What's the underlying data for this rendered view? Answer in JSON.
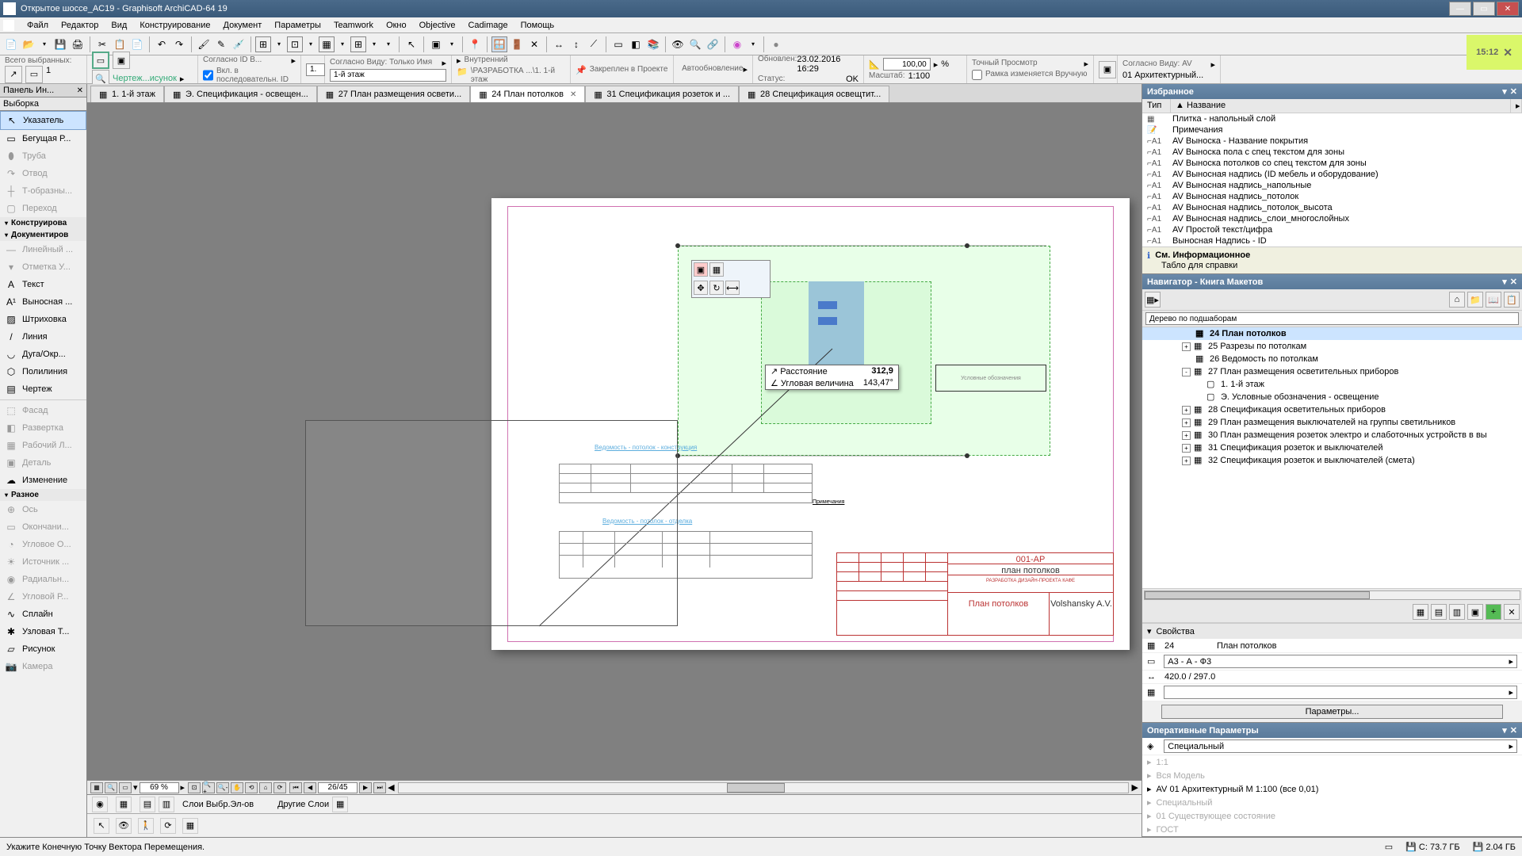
{
  "title": "Открытое шоссе_AC19 - Graphisoft ArchiCAD-64 19",
  "menu": [
    "Файл",
    "Редактор",
    "Вид",
    "Конструирование",
    "Документ",
    "Параметры",
    "Teamwork",
    "Окно",
    "Objective",
    "Cadimage",
    "Помощь"
  ],
  "inforow": {
    "selected_label": "Всего выбранных:",
    "selected_count": "1",
    "draw_label": "Чертеж...исунок",
    "accord_id": "Согласно ID В...",
    "accord_val": "1.",
    "seq_label": "Вкл. в последовательн. ID",
    "accord_view": "Согласно Виду: Только Имя",
    "floor": "1-й этаж",
    "internal": "Внутренний",
    "path": "\\РАЗРАБОТКА ...\\1. 1-й этаж",
    "anchor": "Закреплен в Проекте",
    "auto": "Автообновление",
    "updated_l": "Обновлен:",
    "updated_v": "23.02.2016 16:29",
    "status_l": "Статус:",
    "status_v": "OK",
    "scale_val": "100,00",
    "scale_pct": "%",
    "scale_l": "Масштаб:",
    "scale_r": "1:100",
    "preview": "Точный Просмотр",
    "frame": "Рамка изменяется Вручную",
    "view_l": "Согласно Виду: AV",
    "view_v": "01 Архитектурный..."
  },
  "clock": "15:12",
  "left_tools": {
    "header": "Панель  Ин...",
    "sub": "Выборка",
    "items": [
      {
        "icon": "↖",
        "label": "Указатель",
        "sel": true
      },
      {
        "icon": "▭",
        "label": "Бегущая Р..."
      },
      {
        "icon": "⬮",
        "label": "Труба",
        "dim": true
      },
      {
        "icon": "↷",
        "label": "Отвод",
        "dim": true
      },
      {
        "icon": "┼",
        "label": "Т-образны...",
        "dim": true
      },
      {
        "icon": "▢",
        "label": "Переход",
        "dim": true
      }
    ],
    "sections": [
      {
        "label": "Конструирова",
        "open": true
      },
      {
        "label": "Документиров",
        "open": true
      }
    ],
    "doc_items": [
      {
        "icon": "—",
        "label": "Линейный ...",
        "dim": true
      },
      {
        "icon": "▾",
        "label": "Отметка У...",
        "dim": true
      },
      {
        "icon": "A",
        "label": "Текст"
      },
      {
        "icon": "A¹",
        "label": "Выносная ..."
      },
      {
        "icon": "▨",
        "label": "Штриховка"
      },
      {
        "icon": "/",
        "label": "Линия"
      },
      {
        "icon": "◡",
        "label": "Дуга/Окр..."
      },
      {
        "icon": "⬡",
        "label": "Полилиния"
      },
      {
        "icon": "▤",
        "label": "Чертеж"
      },
      {
        "icon": "---",
        "label": "",
        "dim": true,
        "sep": true
      },
      {
        "icon": "⬚",
        "label": "Фасад",
        "dim": true
      },
      {
        "icon": "◧",
        "label": "Развертка",
        "dim": true
      },
      {
        "icon": "▦",
        "label": "Рабочий Л...",
        "dim": true
      },
      {
        "icon": "▣",
        "label": "Деталь",
        "dim": true
      },
      {
        "icon": "☁",
        "label": "Изменение"
      }
    ],
    "misc_label": "Разное",
    "misc_items": [
      {
        "icon": "⊕",
        "label": "Ось",
        "dim": true
      },
      {
        "icon": "▭",
        "label": "Окончани...",
        "dim": true
      },
      {
        "icon": "◔",
        "label": "Угловое О...",
        "dim": true
      },
      {
        "icon": "☀",
        "label": "Источник ...",
        "dim": true
      },
      {
        "icon": "◉",
        "label": "Радиальн...",
        "dim": true
      },
      {
        "icon": "∠",
        "label": "Угловой Р...",
        "dim": true
      },
      {
        "icon": "∿",
        "label": "Сплайн"
      },
      {
        "icon": "✱",
        "label": "Узловая Т..."
      },
      {
        "icon": "▱",
        "label": "Рисунок"
      },
      {
        "icon": "📷",
        "label": "Камера",
        "dim": true
      }
    ]
  },
  "tabs": [
    {
      "label": "1. 1-й этаж"
    },
    {
      "label": "Э. Спецификация - освещен..."
    },
    {
      "label": "27 План размещения освети..."
    },
    {
      "label": "24 План потолков",
      "active": true,
      "close": true
    },
    {
      "label": "31 Спецификация розеток и ..."
    },
    {
      "label": "28 Спецификация освещтит..."
    }
  ],
  "coord_tip": {
    "dist_l": "Расстояние",
    "dist_v": "312,9",
    "ang_l": "Угловая величина",
    "ang_v": "143,47°"
  },
  "zoom": {
    "pct": "69 %",
    "pages": "26/45"
  },
  "fav": {
    "title": "Избранное",
    "col1": "Тип",
    "col2": "▲ Название",
    "items": [
      {
        "t": "▦",
        "n": "Плитка - напольный слой"
      },
      {
        "t": "📝",
        "n": "Примечания"
      },
      {
        "t": "⌐A1",
        "n": "AV Выноска - Название покрытия"
      },
      {
        "t": "⌐A1",
        "n": "AV Выноска пола с спец текстом для зоны"
      },
      {
        "t": "⌐A1",
        "n": "AV Выноска потолков со спец текстом для зоны"
      },
      {
        "t": "⌐A1",
        "n": "AV Выносная надпись (ID мебель и оборудование)"
      },
      {
        "t": "⌐A1",
        "n": "AV Выносная надпись_напольные"
      },
      {
        "t": "⌐A1",
        "n": "AV Выносная надпись_потолок"
      },
      {
        "t": "⌐A1",
        "n": "AV Выносная надпись_потолок_высота"
      },
      {
        "t": "⌐A1",
        "n": "AV Выносная надпись_слои_многослойных"
      },
      {
        "t": "⌐A1",
        "n": "AV Простой текст/цифра"
      },
      {
        "t": "⌐A1",
        "n": "Выносная Надпись - ID"
      }
    ],
    "msg_title": "См. Информационное",
    "msg_body": "Табло для справки"
  },
  "nav": {
    "title": "Навигатор - Книга Макетов",
    "search_ph": "Дерево по подшаборам",
    "tree": [
      {
        "ind": 3,
        "exp": "",
        "icon": "▦",
        "label": "24 План потолков",
        "sel": true
      },
      {
        "ind": 3,
        "exp": "+",
        "icon": "▦",
        "label": "25 Разрезы по потолкам"
      },
      {
        "ind": 3,
        "exp": "",
        "icon": "▦",
        "label": "26 Ведомость по потолкам"
      },
      {
        "ind": 3,
        "exp": "-",
        "icon": "▦",
        "label": "27 План размещения осветительных приборов"
      },
      {
        "ind": 4,
        "exp": "",
        "icon": "▢",
        "label": "1. 1-й этаж"
      },
      {
        "ind": 4,
        "exp": "",
        "icon": "▢",
        "label": "Э. Условные обозначения - освещение"
      },
      {
        "ind": 3,
        "exp": "+",
        "icon": "▦",
        "label": "28 Спецификация осветительных приборов"
      },
      {
        "ind": 3,
        "exp": "+",
        "icon": "▦",
        "label": "29 План размещения выключателей на группы светильников"
      },
      {
        "ind": 3,
        "exp": "+",
        "icon": "▦",
        "label": "30 План размещения розеток электро и слаботочных устройств в вы"
      },
      {
        "ind": 3,
        "exp": "+",
        "icon": "▦",
        "label": "31 Спецификация розеток и выключателей"
      },
      {
        "ind": 3,
        "exp": "+",
        "icon": "▦",
        "label": "32 Спецификация розеток и выключателей (смета)"
      }
    ]
  },
  "props": {
    "title": "Свойства",
    "id": "24",
    "name": "План потолков",
    "format": "А3 - А - Ф3",
    "size": "420.0 / 297.0",
    "btn": "Параметры..."
  },
  "oper": {
    "title": "Оперативные Параметры",
    "special": "Специальный",
    "items": [
      {
        "l": "1:1",
        "dim": true
      },
      {
        "l": "Вся Модель",
        "dim": true
      },
      {
        "l": "AV 01 Архитектурный М 1:100 (все 0,01)"
      },
      {
        "l": "Специальный",
        "dim": true
      },
      {
        "l": "01 Существующее состояние",
        "dim": true
      },
      {
        "l": "ГОСТ",
        "dim": true
      }
    ]
  },
  "layers": {
    "l1": "Слои Выбр.Эл-ов",
    "l2": "Другие Слои"
  },
  "status": {
    "msg": "Укажите Конечную Точку Вектора Перемещения.",
    "disk1": "C: 73.7 ГБ",
    "disk2": "2.04 ГБ"
  },
  "canvas_text": {
    "blue1": "Ведомость - потолок - конструкция",
    "blue2": "Ведомость - потолок - отделка",
    "prim": "Примечания",
    "stamp1": "001-АР",
    "stamp2": "план потолков",
    "stamp3": "РАЗРАБОТКА ДИЗАЙН-ПРОЕКТА КАФЕ",
    "stamp4": "План потолков",
    "stamp5": "Volshansky A.V.",
    "usl": "Условные обозначения"
  }
}
